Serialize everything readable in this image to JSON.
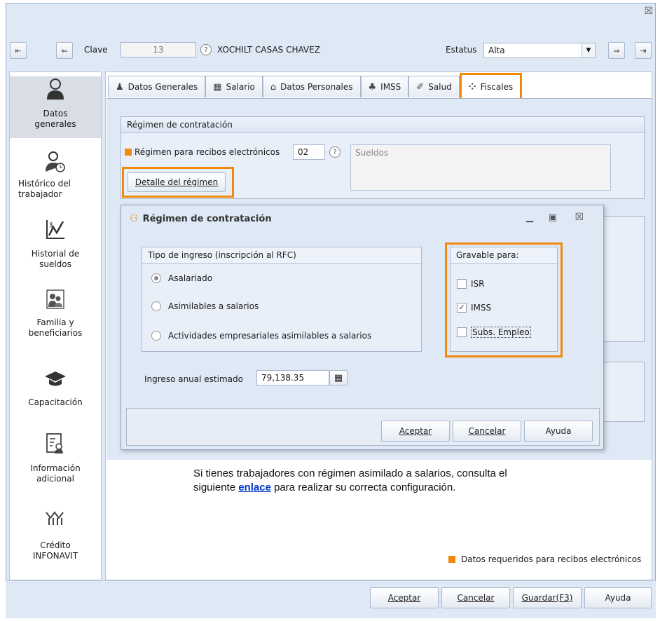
{
  "window": {
    "close_glyph": "☒"
  },
  "toolbar": {
    "first_glyph": "⇤",
    "prev_glyph": "⇐",
    "next_glyph": "⇒",
    "last_glyph": "⇥",
    "clave_label": "Clave",
    "clave_value": "13",
    "employee_name": "XOCHILT CASAS CHAVEZ",
    "estatus_label": "Estatus",
    "estatus_value": "Alta"
  },
  "sidebar": {
    "items": [
      {
        "label": "Datos generales",
        "icon": "person-icon"
      },
      {
        "label": "Histórico del trabajador",
        "icon": "person-clock-icon"
      },
      {
        "label": "Historial de sueldos",
        "icon": "salary-chart-icon"
      },
      {
        "label": "Familia y beneficiarios",
        "icon": "family-icon"
      },
      {
        "label": "Capacitación",
        "icon": "graduation-cap-icon"
      },
      {
        "label": "Información adicional",
        "icon": "info-card-icon"
      },
      {
        "label": "Crédito INFONAVIT",
        "icon": "infonavit-icon"
      }
    ]
  },
  "tabs": [
    {
      "label": "Datos Generales"
    },
    {
      "label": "Salario"
    },
    {
      "label": "Datos Personales"
    },
    {
      "label": "IMSS"
    },
    {
      "label": "Salud"
    },
    {
      "label": "Fiscales"
    }
  ],
  "regimen": {
    "group_title": "Régimen de contratación",
    "field_label": "Régimen para recibos electrónicos",
    "field_value": "02",
    "description": "Sueldos",
    "detail_button": "Detalle del régimen"
  },
  "modal": {
    "title": "Régimen de contratación",
    "tipo_title": "Tipo de ingreso (inscripción al RFC)",
    "options": [
      {
        "label": "Asalariado",
        "selected": true
      },
      {
        "label": "Asimilables a salarios",
        "selected": false
      },
      {
        "label": "Actividades empresariales asimilables a salarios",
        "selected": false
      }
    ],
    "gravable_title": "Gravable para:",
    "gravable": [
      {
        "label": "ISR",
        "checked": false
      },
      {
        "label": "IMSS",
        "checked": true
      },
      {
        "label": "Subs. Empleo",
        "checked": false
      }
    ],
    "ingreso_label": "Ingreso anual estimado",
    "ingreso_value": "79,138.35",
    "buttons": {
      "aceptar": "Aceptar",
      "cancelar": "Cancelar",
      "ayuda": "Ayuda"
    }
  },
  "info": {
    "line1": "Si tienes trabajadores con régimen asimilado a salarios, consulta el",
    "line2_prefix": "siguiente ",
    "link": "enlace",
    "line2_suffix": " para realizar su correcta configuración."
  },
  "required_note": "Datos requeridos para recibos electrónicos",
  "footer": {
    "aceptar": "Aceptar",
    "cancelar": "Cancelar",
    "guardar": "Guardar(F3)",
    "ayuda": "Ayuda"
  },
  "colors": {
    "accent": "#f0890d",
    "link": "#0033cc",
    "panel": "#dfe8f5"
  }
}
